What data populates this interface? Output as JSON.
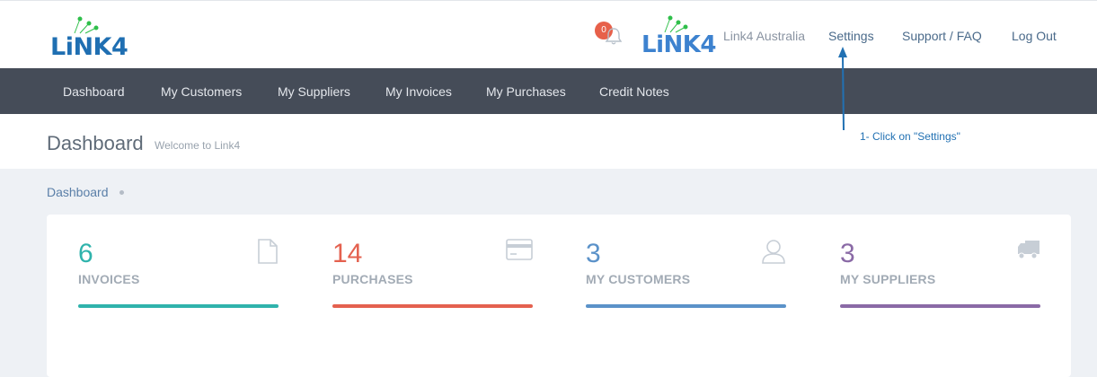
{
  "header": {
    "logo_text": "LiNK4",
    "notification_count": "0",
    "company_name": "Link4 Australia",
    "links": {
      "settings": "Settings",
      "support": "Support / FAQ",
      "logout": "Log Out"
    }
  },
  "nav": {
    "items": [
      "Dashboard",
      "My Customers",
      "My Suppliers",
      "My Invoices",
      "My Purchases",
      "Credit Notes"
    ]
  },
  "page": {
    "title": "Dashboard",
    "subtitle": "Welcome to Link4",
    "breadcrumb": "Dashboard"
  },
  "annotation": {
    "text": "1- Click on \"Settings\""
  },
  "stats": [
    {
      "value": "6",
      "label": "INVOICES",
      "color": "#2fb3ac",
      "icon": "document-icon"
    },
    {
      "value": "14",
      "label": "PURCHASES",
      "color": "#e4614f",
      "icon": "credit-card-icon"
    },
    {
      "value": "3",
      "label": "MY CUSTOMERS",
      "color": "#5b92c9",
      "icon": "user-icon"
    },
    {
      "value": "3",
      "label": "MY SUPPLIERS",
      "color": "#8a6aa6",
      "icon": "truck-icon"
    }
  ],
  "colors": {
    "navbar": "#454c58",
    "logo_blue": "#1f6fb2",
    "logo_green": "#2fbf4a",
    "annotation": "#2271b3"
  }
}
